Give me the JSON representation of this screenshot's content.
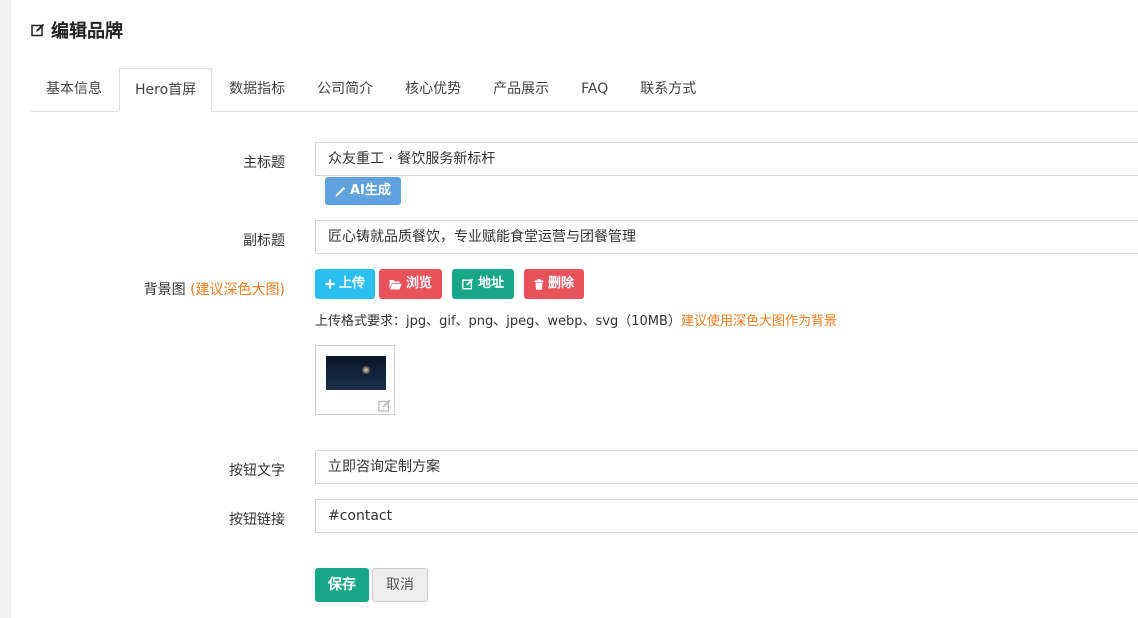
{
  "header": {
    "title": "编辑品牌",
    "icon": "edit-icon"
  },
  "tabs": [
    {
      "label": "基本信息",
      "active": false
    },
    {
      "label": "Hero首屏",
      "active": true
    },
    {
      "label": "数据指标",
      "active": false
    },
    {
      "label": "公司简介",
      "active": false
    },
    {
      "label": "核心优势",
      "active": false
    },
    {
      "label": "产品展示",
      "active": false
    },
    {
      "label": "FAQ",
      "active": false
    },
    {
      "label": "联系方式",
      "active": false
    }
  ],
  "form": {
    "main_title": {
      "label": "主标题",
      "value": "众友重工 · 餐饮服务新标杆",
      "ai_button": "AI生成"
    },
    "subtitle": {
      "label": "副标题",
      "value": "匠心铸就品质餐饮，专业赋能食堂运营与团餐管理"
    },
    "background": {
      "label": "背景图",
      "hint": "(建议深色大图)",
      "upload_button": "上传",
      "browse_button": "浏览",
      "address_button": "地址",
      "delete_button": "删除",
      "format_tip": "上传格式要求：jpg、gif、png、jpeg、webp、svg（10MB）",
      "format_tip_highlight": "建议使用深色大图作为背景"
    },
    "button_text": {
      "label": "按钮文字",
      "value": "立即咨询定制方案"
    },
    "button_link": {
      "label": "按钮链接",
      "value": "#contact"
    },
    "save_button": "保存",
    "cancel_button": "取消"
  },
  "colors": {
    "primary_green": "#18a689",
    "danger_red": "#e8525a",
    "info_blue": "#2bbff0",
    "ai_blue": "#5fa2dd",
    "hint_orange": "#f37b1d"
  }
}
